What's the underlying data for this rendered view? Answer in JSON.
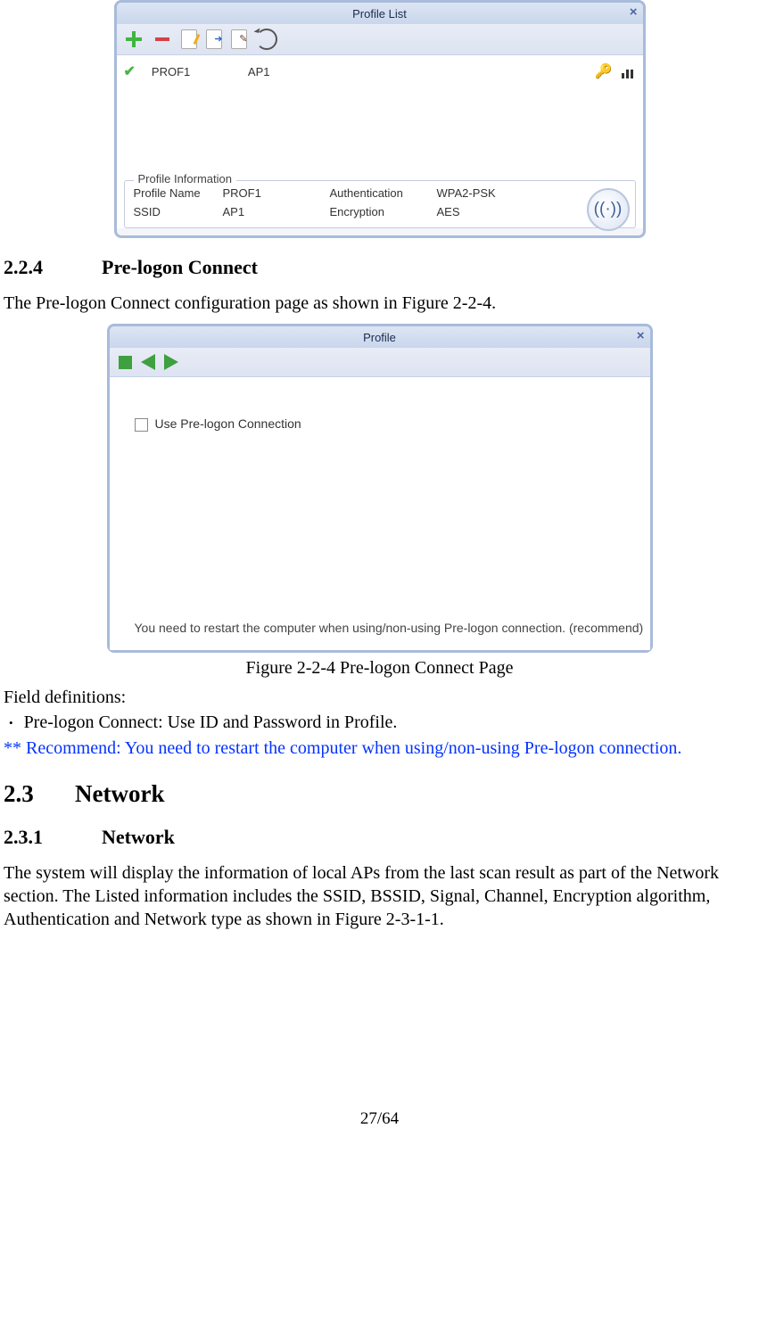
{
  "figure1": {
    "titlebar": "Profile List",
    "list": {
      "items": [
        {
          "name": "PROF1",
          "ap": "AP1"
        }
      ]
    },
    "info": {
      "legend": "Profile Information",
      "profile_name_label": "Profile Name",
      "profile_name_value": "PROF1",
      "ssid_label": "SSID",
      "ssid_value": "AP1",
      "auth_label": "Authentication",
      "auth_value": "WPA2-PSK",
      "enc_label": "Encryption",
      "enc_value": "AES"
    }
  },
  "sec224": {
    "num": "2.2.4",
    "title": "Pre-logon Connect",
    "intro": "The Pre-logon Connect configuration page as shown in Figure 2-2-4."
  },
  "figure2": {
    "titlebar": "Profile",
    "checkbox_label": "Use Pre-logon Connection",
    "note": "You need to restart the computer when using/non-using Pre-logon connection. (recommend)",
    "caption": "Figure 2-2-4 Pre-logon Connect Page"
  },
  "defs": {
    "heading": "Field definitions:",
    "bullet1": "Pre-logon Connect: Use ID and Password in Profile.",
    "recommend": "** Recommend: You need to restart the computer when using/non-using Pre-logon connection."
  },
  "sec23": {
    "num": "2.3",
    "title": "Network"
  },
  "sec231": {
    "num": "2.3.1",
    "title": "Network",
    "body": "The system will display the information of local APs from the last scan result as part of the Network section. The Listed information includes the SSID, BSSID, Signal, Channel, Encryption algorithm, Authentication and Network type as shown in Figure 2-3-1-1."
  },
  "page_number": "27/64"
}
